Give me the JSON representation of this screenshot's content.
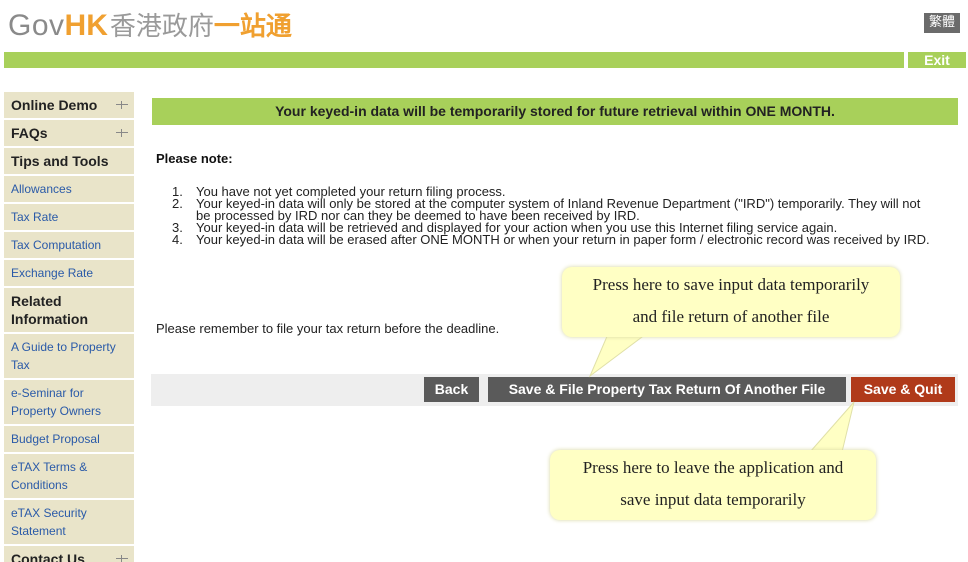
{
  "header": {
    "logo_gov": "Gov",
    "logo_hk": "HK",
    "logo_cn_grey": "香港政府",
    "logo_cn_orange": "一站通",
    "lang_button": "繁體",
    "exit_label": "Exit"
  },
  "sidebar": {
    "items": [
      {
        "label": "Online Demo",
        "type": "head",
        "expandable": true
      },
      {
        "label": "FAQs",
        "type": "head",
        "expandable": true
      },
      {
        "label": "Tips and Tools",
        "type": "head",
        "expandable": false
      },
      {
        "label": "Allowances",
        "type": "link"
      },
      {
        "label": "Tax Rate",
        "type": "link"
      },
      {
        "label": "Tax Computation",
        "type": "link"
      },
      {
        "label": "Exchange Rate",
        "type": "link"
      },
      {
        "label": "Related Information",
        "type": "head",
        "expandable": false
      },
      {
        "label": "A Guide to Property Tax",
        "type": "link"
      },
      {
        "label": "e-Seminar for Property Owners",
        "type": "link"
      },
      {
        "label": "Budget Proposal",
        "type": "link"
      },
      {
        "label": "eTAX Terms & Conditions",
        "type": "link"
      },
      {
        "label": "eTAX Security Statement",
        "type": "link"
      },
      {
        "label": "Contact Us",
        "type": "head",
        "expandable": true
      }
    ]
  },
  "main": {
    "banner": "Your keyed-in data will be temporarily stored for future retrieval within ONE MONTH.",
    "note_title": "Please note:",
    "notes": [
      {
        "num": "1.",
        "text": "You have not yet completed your return filing process."
      },
      {
        "num": "2.",
        "text": "Your keyed-in data will only be stored at the computer system of Inland Revenue Department (\"IRD\") temporarily. They will not be processed by IRD nor can they be deemed to have been received by IRD."
      },
      {
        "num": "3.",
        "text": "Your keyed-in data will be retrieved and displayed for your action when you use this Internet filing service again."
      },
      {
        "num": "4.",
        "text": "Your keyed-in data will be erased after ONE MONTH or when your return in paper form / electronic record was received by IRD."
      }
    ],
    "remember": "Please remember to file your tax return before the deadline.",
    "buttons": {
      "back": "Back",
      "save_file": "Save & File Property Tax Return Of Another File",
      "save_quit": "Save & Quit"
    }
  },
  "callouts": {
    "one_line1": "Press here to save input data temporarily",
    "one_line2": "and file return of another file",
    "two_line1": "Press here to leave the application and",
    "two_line2": "save input data temporarily"
  },
  "colors": {
    "accent_green": "#a8d05a",
    "button_grey": "#5a5a5a",
    "button_red": "#b03a1a",
    "sidebar_bg": "#e9e4c9",
    "callout_bg": "#ffffc4"
  }
}
